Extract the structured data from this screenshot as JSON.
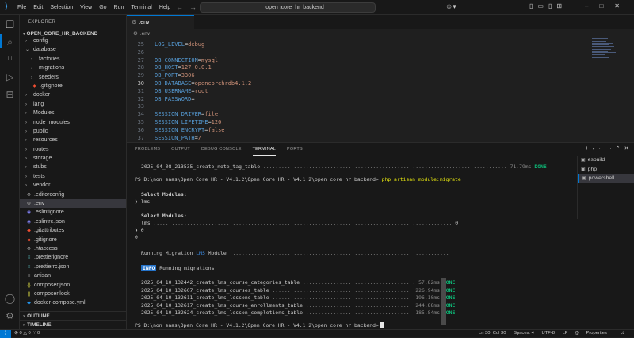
{
  "titlebar": {
    "menu": [
      "File",
      "Edit",
      "Selection",
      "View",
      "Go",
      "Run",
      "Terminal",
      "Help"
    ],
    "search": "open_core_hr_backend"
  },
  "sidebar": {
    "title": "EXPLORER",
    "project": "OPEN_CORE_HR_BACKEND",
    "tree": [
      {
        "label": "config",
        "type": "folder",
        "indent": 1,
        "open": false
      },
      {
        "label": "database",
        "type": "folder",
        "indent": 1,
        "open": true
      },
      {
        "label": "factories",
        "type": "folder",
        "indent": 2,
        "open": false
      },
      {
        "label": "migrations",
        "type": "folder",
        "indent": 2,
        "open": false
      },
      {
        "label": "seeders",
        "type": "folder",
        "indent": 2,
        "open": false
      },
      {
        "label": ".gitignore",
        "type": "file",
        "indent": 2,
        "icon": "git"
      },
      {
        "label": "docker",
        "type": "folder",
        "indent": 1,
        "open": false
      },
      {
        "label": "lang",
        "type": "folder",
        "indent": 1,
        "open": false
      },
      {
        "label": "Modules",
        "type": "folder",
        "indent": 1,
        "open": false
      },
      {
        "label": "node_modules",
        "type": "folder",
        "indent": 1,
        "open": false
      },
      {
        "label": "public",
        "type": "folder",
        "indent": 1,
        "open": false
      },
      {
        "label": "resources",
        "type": "folder",
        "indent": 1,
        "open": false
      },
      {
        "label": "routes",
        "type": "folder",
        "indent": 1,
        "open": false
      },
      {
        "label": "storage",
        "type": "folder",
        "indent": 1,
        "open": false
      },
      {
        "label": "stubs",
        "type": "folder",
        "indent": 1,
        "open": false
      },
      {
        "label": "tests",
        "type": "folder",
        "indent": 1,
        "open": false
      },
      {
        "label": "vendor",
        "type": "folder",
        "indent": 1,
        "open": false
      },
      {
        "label": ".editorconfig",
        "type": "file",
        "indent": 1,
        "icon": "gear"
      },
      {
        "label": ".env",
        "type": "file",
        "indent": 1,
        "icon": "gear",
        "selected": true
      },
      {
        "label": ".eslintignore",
        "type": "file",
        "indent": 1,
        "icon": "eslint"
      },
      {
        "label": ".eslintrc.json",
        "type": "file",
        "indent": 1,
        "icon": "eslint"
      },
      {
        "label": ".gitattributes",
        "type": "file",
        "indent": 1,
        "icon": "git"
      },
      {
        "label": ".gitignore",
        "type": "file",
        "indent": 1,
        "icon": "git"
      },
      {
        "label": ".htaccess",
        "type": "file",
        "indent": 1,
        "icon": "gear"
      },
      {
        "label": ".prettierignore",
        "type": "file",
        "indent": 1,
        "icon": "prettier"
      },
      {
        "label": ".prettierrc.json",
        "type": "file",
        "indent": 1,
        "icon": "prettier"
      },
      {
        "label": "artisan",
        "type": "file",
        "indent": 1,
        "icon": "text"
      },
      {
        "label": "composer.json",
        "type": "file",
        "indent": 1,
        "icon": "json"
      },
      {
        "label": "composer.lock",
        "type": "file",
        "indent": 1,
        "icon": "json"
      },
      {
        "label": "docker-compose.yml",
        "type": "file",
        "indent": 1,
        "icon": "docker"
      }
    ],
    "sections": [
      "OUTLINE",
      "TIMELINE"
    ]
  },
  "editor": {
    "tab": ".env",
    "breadcrumb": ".env",
    "lines": [
      {
        "n": "25",
        "key": "LOG_LEVEL",
        "val": "debug"
      },
      {
        "n": "26",
        "key": "",
        "val": ""
      },
      {
        "n": "27",
        "key": "DB_CONNECTION",
        "val": "mysql"
      },
      {
        "n": "28",
        "key": "DB_HOST",
        "val": "127.0.0.1"
      },
      {
        "n": "29",
        "key": "DB_PORT",
        "val": "3306"
      },
      {
        "n": "30",
        "key": "DB_DATABASE",
        "val": "opencorehrdb4.1.2",
        "current": true
      },
      {
        "n": "31",
        "key": "DB_USERNAME",
        "val": "root"
      },
      {
        "n": "32",
        "key": "DB_PASSWORD",
        "val": ""
      },
      {
        "n": "33",
        "key": "",
        "val": ""
      },
      {
        "n": "34",
        "key": "SESSION_DRIVER",
        "val": "file"
      },
      {
        "n": "35",
        "key": "SESSION_LIFETIME",
        "val": "120"
      },
      {
        "n": "36",
        "key": "SESSION_ENCRYPT",
        "val": "false"
      },
      {
        "n": "37",
        "key": "SESSION_PATH",
        "val": "/"
      }
    ]
  },
  "panel": {
    "tabs": [
      "PROBLEMS",
      "OUTPUT",
      "DEBUG CONSOLE",
      "TERMINAL",
      "PORTS"
    ],
    "active_tab": "TERMINAL",
    "terminals": [
      "esbuild",
      "php",
      "powershell"
    ],
    "active_terminal": "powershell",
    "terminal": {
      "line_prev_name": "2025_04_08_213535_create_note_tag_table",
      "line_prev_time": "71.79ms",
      "done": "DONE",
      "prompt1": "PS D:\\non saas\\Open Core HR - V4.1.2\\Open Core HR - V4.1.2\\open_core_hr_backend>",
      "command": "php artisan module:migrate",
      "select_modules": "Select Modules:",
      "lms": "lms",
      "lms_option": "lms",
      "lms_count": "0",
      "zero_a": "0",
      "zero_b": "0",
      "running_prefix": "Running Migration ",
      "running_module": "LMS",
      "running_suffix": " Module",
      "info": "INFO",
      "info_text": "Running migrations.",
      "migrations": [
        {
          "name": "2025_04_10_132442_create_lms_course_categories_table",
          "time": "57.82ms"
        },
        {
          "name": "2025_04_10_132607_create_lms_courses_table",
          "time": "226.94ms"
        },
        {
          "name": "2025_04_10_132611_create_lms_lessons_table",
          "time": "196.10ms"
        },
        {
          "name": "2025_04_10_132617_create_lms_course_enrollments_table",
          "time": "244.88ms"
        },
        {
          "name": "2025_04_10_132624_create_lms_lesson_completions_table",
          "time": "185.84ms"
        }
      ],
      "prompt2": "PS D:\\non saas\\Open Core HR - V4.1.2\\Open Core HR - V4.1.2\\open_core_hr_backend>"
    }
  },
  "statusbar": {
    "errors": "0",
    "warnings": "0",
    "ports": "0",
    "position": "Ln 30, Col 30",
    "spaces": "Spaces: 4",
    "encoding": "UTF-8",
    "eol": "LF",
    "language": "Properties"
  },
  "colors": {
    "accent": "#0078d4",
    "done": "#0dbc79",
    "info": "#2472c8"
  }
}
